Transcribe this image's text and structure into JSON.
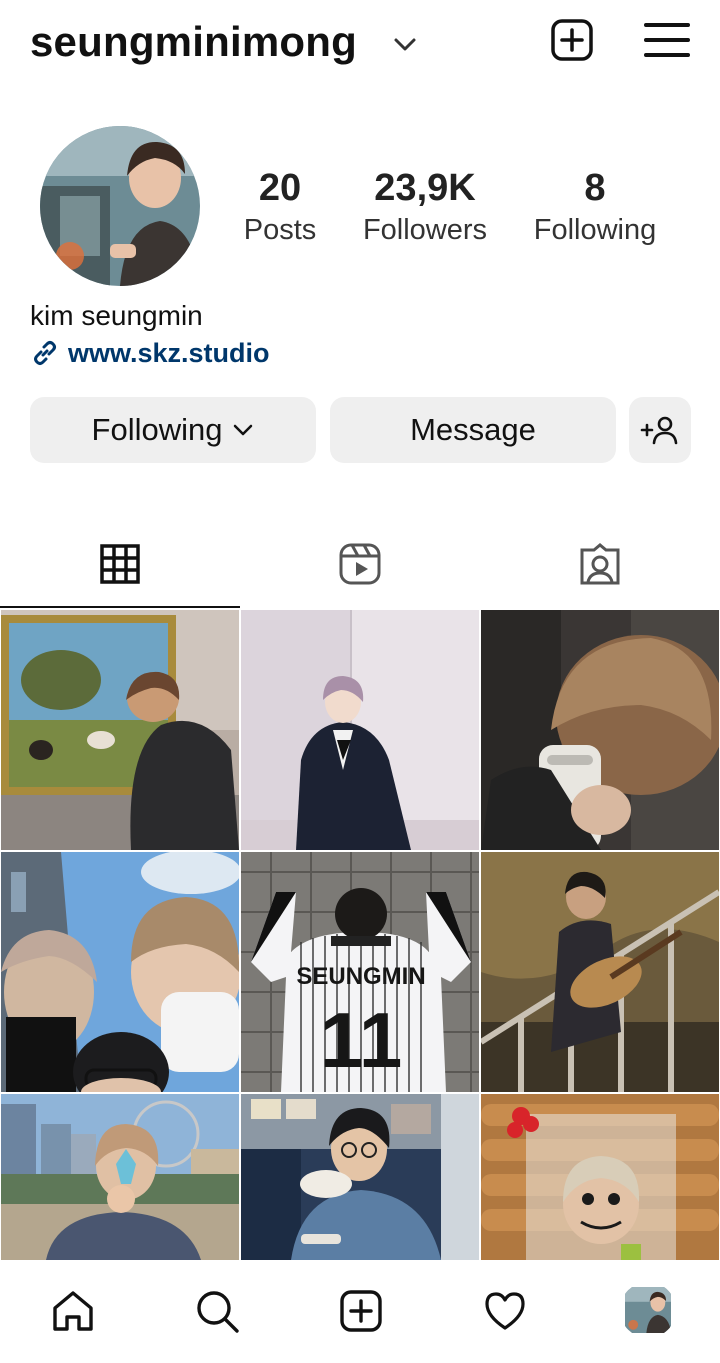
{
  "header": {
    "username": "seungminimong",
    "icons": {
      "chevron": "chevron-down-icon",
      "create": "plus-square-icon",
      "menu": "hamburger-menu-icon"
    }
  },
  "profile": {
    "stats": [
      {
        "value": "20",
        "label": "Posts"
      },
      {
        "value": "23,9K",
        "label": "Followers"
      },
      {
        "value": "8",
        "label": "Following"
      }
    ],
    "display_name": "kim seungmin",
    "link": "www.skz.studio"
  },
  "actions": {
    "following_label": "Following",
    "message_label": "Message"
  },
  "tabs": [
    "grid-icon",
    "reels-icon",
    "tagged-icon"
  ],
  "posts": [
    {
      "subject": "painting-gallery"
    },
    {
      "subject": "black-suit-portrait"
    },
    {
      "subject": "mirror-selfie"
    },
    {
      "subject": "selfie-with-friend"
    },
    {
      "subject": "striped-jersey-11",
      "jersey_name": "SEUNGMIN",
      "jersey_number": "11"
    },
    {
      "subject": "guitar-on-stairs"
    },
    {
      "subject": "ferris-wheel-city"
    },
    {
      "subject": "eating-noodles"
    },
    {
      "subject": "face-behind-plastic"
    }
  ],
  "bottom_nav": [
    "home-icon",
    "search-icon",
    "create-icon",
    "heart-icon",
    "profile-avatar"
  ],
  "colors": {
    "link": "#00376b",
    "button_bg": "#efefef",
    "text": "#111111"
  }
}
